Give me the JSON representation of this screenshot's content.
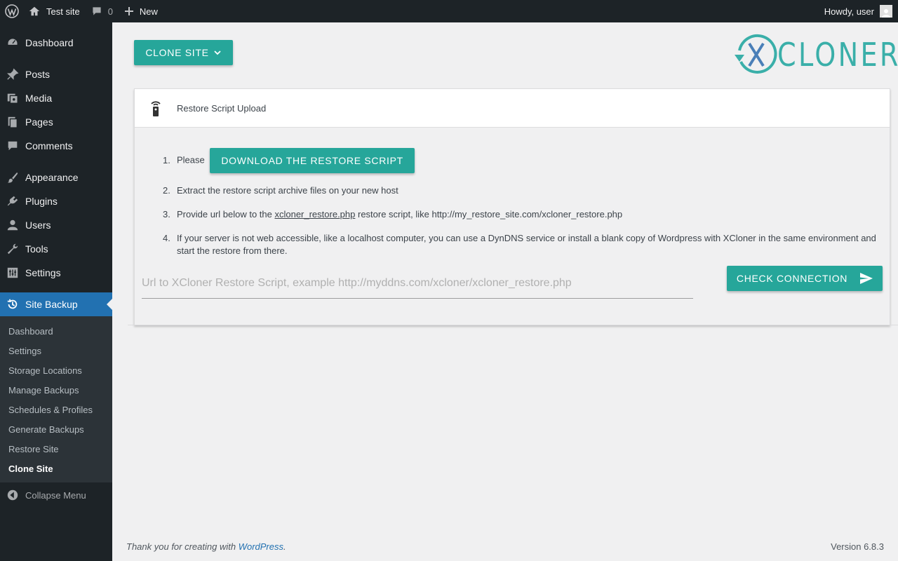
{
  "adminbar": {
    "site_name": "Test site",
    "comments_count": "0",
    "new_label": "New",
    "howdy": "Howdy, user"
  },
  "sidebar": {
    "items": [
      {
        "label": "Dashboard",
        "icon": "dashboard-icon"
      },
      {
        "label": "Posts",
        "icon": "pin-icon"
      },
      {
        "label": "Media",
        "icon": "media-icon"
      },
      {
        "label": "Pages",
        "icon": "pages-icon"
      },
      {
        "label": "Comments",
        "icon": "comment-icon"
      },
      {
        "label": "Appearance",
        "icon": "brush-icon"
      },
      {
        "label": "Plugins",
        "icon": "plug-icon"
      },
      {
        "label": "Users",
        "icon": "user-icon"
      },
      {
        "label": "Tools",
        "icon": "wrench-icon"
      },
      {
        "label": "Settings",
        "icon": "settings-icon"
      }
    ],
    "current": {
      "label": "Site Backup",
      "icon": "history-icon"
    },
    "submenu": [
      "Dashboard",
      "Settings",
      "Storage Locations",
      "Manage Backups",
      "Schedules & Profiles",
      "Generate Backups",
      "Restore Site",
      "Clone Site"
    ],
    "active_sub": "Clone Site",
    "collapse_label": "Collapse Menu"
  },
  "main": {
    "clone_button": "CLONE SITE",
    "logo_text": "CLONER",
    "card_title": "Restore Script Upload",
    "steps": {
      "s1_num": "1.",
      "s1_text": "Please",
      "download_button": "DOWNLOAD THE RESTORE SCRIPT",
      "s2_num": "2.",
      "s2_text": "Extract the restore script archive files on your new host",
      "s3_num": "3.",
      "s3_pre": "Provide url below to the ",
      "s3_link": "xcloner_restore.php",
      "s3_post": " restore script, like http://my_restore_site.com/xcloner_restore.php",
      "s4_num": "4.",
      "s4_text": "If your server is not web accessible, like a localhost computer, you can use a DynDNS service or install a blank copy of Wordpress with XCloner in the same environment and start the restore from there."
    },
    "url_placeholder": "Url to XCloner Restore Script, example http://myddns.com/xcloner/xcloner_restore.php",
    "url_value": "",
    "check_button": "CHECK CONNECTION"
  },
  "footer": {
    "thanks_pre": "Thank you for creating with ",
    "thanks_link": "WordPress",
    "thanks_post": ".",
    "version": "Version 6.8.3"
  },
  "colors": {
    "accent": "#26a69a",
    "admin_dark": "#1d2327",
    "wp_blue": "#2271b1",
    "logo_teal": "#3aafa9",
    "logo_blue": "#4a7fb8"
  }
}
